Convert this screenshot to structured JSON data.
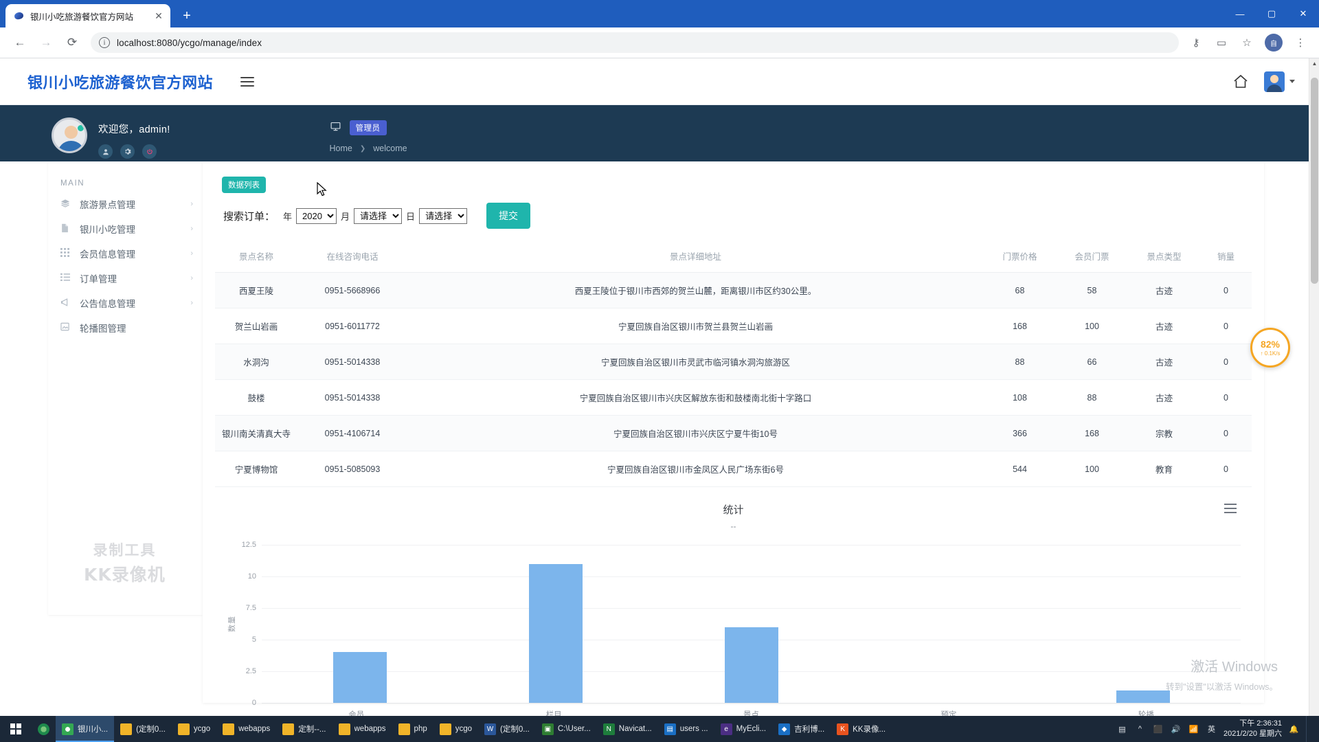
{
  "browser": {
    "tab_title": "银川小吃旅游餐饮官方网站",
    "tab_close": "✕",
    "new_tab": "+",
    "back": "←",
    "forward": "→",
    "reload": "⟳",
    "info_icon": "i",
    "url": "localhost:8080/ycgo/manage/index",
    "key_icon": "⚷",
    "cast_icon": "▭",
    "star_icon": "☆",
    "profile_initials": "自",
    "menu_icon": "⋮",
    "win_minimize": "—",
    "win_maximize": "▢",
    "win_close": "✕"
  },
  "site": {
    "brand": "银川小吃旅游餐饮官方网站",
    "hamburger": "menu-icon",
    "home_icon": "⌂",
    "avatar_caret": "▾"
  },
  "userbar": {
    "welcome": "欢迎您，admin!",
    "icon_user": "👤",
    "icon_gear": "⚙",
    "icon_power": "⏻",
    "monitor_icon": "🖵",
    "role_chip": "管理员",
    "breadcrumb": [
      "Home",
      "welcome"
    ],
    "breadcrumb_sep": "❯"
  },
  "sidebar": {
    "title": "MAIN",
    "items": [
      {
        "label": "旅游景点管理",
        "icon": "layers-icon",
        "glyph": "◈",
        "arrow": "›"
      },
      {
        "label": "银川小吃管理",
        "icon": "file-icon",
        "glyph": "▤",
        "arrow": "›"
      },
      {
        "label": "会员信息管理",
        "icon": "grid-icon",
        "glyph": "▦",
        "arrow": "›"
      },
      {
        "label": "订单管理",
        "icon": "list-icon",
        "glyph": "☰",
        "arrow": "›"
      },
      {
        "label": "公告信息管理",
        "icon": "megaphone-icon",
        "glyph": "◑",
        "arrow": "›"
      },
      {
        "label": "轮播图管理",
        "icon": "image-icon",
        "glyph": "▣",
        "arrow": ""
      }
    ]
  },
  "panel": {
    "chip": "数据列表",
    "search_label": "搜索订单：",
    "unit_year": "年",
    "unit_month": "月",
    "unit_day": "日",
    "year_value": "2020",
    "month_value": "请选择",
    "day_value": "请选择",
    "submit_label": "提交"
  },
  "table": {
    "headers": [
      "景点名称",
      "在线咨询电话",
      "景点详细地址",
      "门票价格",
      "会员门票",
      "景点类型",
      "销量"
    ],
    "rows": [
      {
        "name": "西夏王陵",
        "phone": "0951-5668966",
        "addr": "西夏王陵位于银川市西郊的贺兰山麓，距离银川市区约30公里。",
        "price": "68",
        "vip": "58",
        "type": "古迹",
        "sales": "0"
      },
      {
        "name": "贺兰山岩画",
        "phone": "0951-6011772",
        "addr": "宁夏回族自治区银川市贺兰县贺兰山岩画",
        "price": "168",
        "vip": "100",
        "type": "古迹",
        "sales": "0"
      },
      {
        "name": "水洞沟",
        "phone": "0951-5014338",
        "addr": "宁夏回族自治区银川市灵武市临河镇水洞沟旅游区",
        "price": "88",
        "vip": "66",
        "type": "古迹",
        "sales": "0"
      },
      {
        "name": "鼓楼",
        "phone": "0951-5014338",
        "addr": "宁夏回族自治区银川市兴庆区解放东街和鼓楼南北街十字路口",
        "price": "108",
        "vip": "88",
        "type": "古迹",
        "sales": "0"
      },
      {
        "name": "银川南关清真大寺",
        "phone": "0951-4106714",
        "addr": "宁夏回族自治区银川市兴庆区宁夏牛街10号",
        "price": "366",
        "vip": "168",
        "type": "宗教",
        "sales": "0"
      },
      {
        "name": "宁夏博物馆",
        "phone": "0951-5085093",
        "addr": "宁夏回族自治区银川市金凤区人民广场东街6号",
        "price": "544",
        "vip": "100",
        "type": "教育",
        "sales": "0"
      }
    ]
  },
  "chart_data": {
    "type": "bar",
    "title": "统计",
    "subtitle": "--",
    "xlabel": "",
    "ylabel": "数量",
    "categories": [
      "会员",
      "栏目",
      "景点",
      "预定",
      "轮播"
    ],
    "values": [
      4,
      11,
      6,
      0,
      1
    ],
    "yticks": [
      0,
      2.5,
      5,
      7.5,
      10,
      12.5
    ],
    "ylim": [
      0,
      12.5
    ],
    "grid": true,
    "legend": "none",
    "series_color": "#7cb5ec",
    "menu_icon": "hamburger-icon"
  },
  "widgets": {
    "speed_percent": "82%",
    "speed_rate": "↑ 0.1K/s",
    "watermark_line1": "录制工具",
    "watermark_line2": "KK录像机",
    "activate_line1": "激活 Windows",
    "activate_line2": "转到\"设置\"以激活 Windows。"
  },
  "taskbar": {
    "start_icon": "windows-logo",
    "items": [
      {
        "label": "银川小...",
        "icon": "chrome-icon",
        "glyph": "",
        "style": "ic-chrome",
        "active": true
      },
      {
        "label": "(定制0...",
        "icon": "folder-icon",
        "glyph": "",
        "style": "ic-folder",
        "active": false
      },
      {
        "label": "ycgo",
        "icon": "folder-icon",
        "glyph": "",
        "style": "ic-folder",
        "active": false
      },
      {
        "label": "webapps",
        "icon": "folder-icon",
        "glyph": "",
        "style": "ic-folder",
        "active": false
      },
      {
        "label": "定制--...",
        "icon": "folder-icon",
        "glyph": "",
        "style": "ic-folder",
        "active": false
      },
      {
        "label": "webapps",
        "icon": "folder-icon",
        "glyph": "",
        "style": "ic-folder",
        "active": false
      },
      {
        "label": "php",
        "icon": "folder-icon",
        "glyph": "",
        "style": "ic-folder",
        "active": false
      },
      {
        "label": "ycgo",
        "icon": "folder-icon",
        "glyph": "",
        "style": "ic-folder",
        "active": false
      },
      {
        "label": "(定制0...",
        "icon": "word-icon",
        "glyph": "W",
        "style": "ic-word",
        "active": false
      },
      {
        "label": "C:\\User...",
        "icon": "terminal-icon",
        "glyph": "▣",
        "style": "ic-green",
        "active": false
      },
      {
        "label": "Navicat...",
        "icon": "navicat-icon",
        "glyph": "N",
        "style": "ic-navicat",
        "active": false
      },
      {
        "label": "users ...",
        "icon": "window-icon",
        "glyph": "▤",
        "style": "ic-blue",
        "active": false
      },
      {
        "label": "MyEcli...",
        "icon": "eclipse-icon",
        "glyph": "e",
        "style": "ic-eclipse",
        "active": false
      },
      {
        "label": "吉利博...",
        "icon": "app-icon",
        "glyph": "◆",
        "style": "ic-blue",
        "active": false
      },
      {
        "label": "KK录像...",
        "icon": "kk-icon",
        "glyph": "K",
        "style": "ic-orange",
        "active": false
      }
    ],
    "tray": {
      "icons": [
        "▤",
        "^",
        "⬛",
        "🔊",
        "📶",
        "🔔"
      ],
      "ime": "英",
      "time": "下午 2:36:31",
      "date": "2021/2/20 星期六"
    }
  }
}
